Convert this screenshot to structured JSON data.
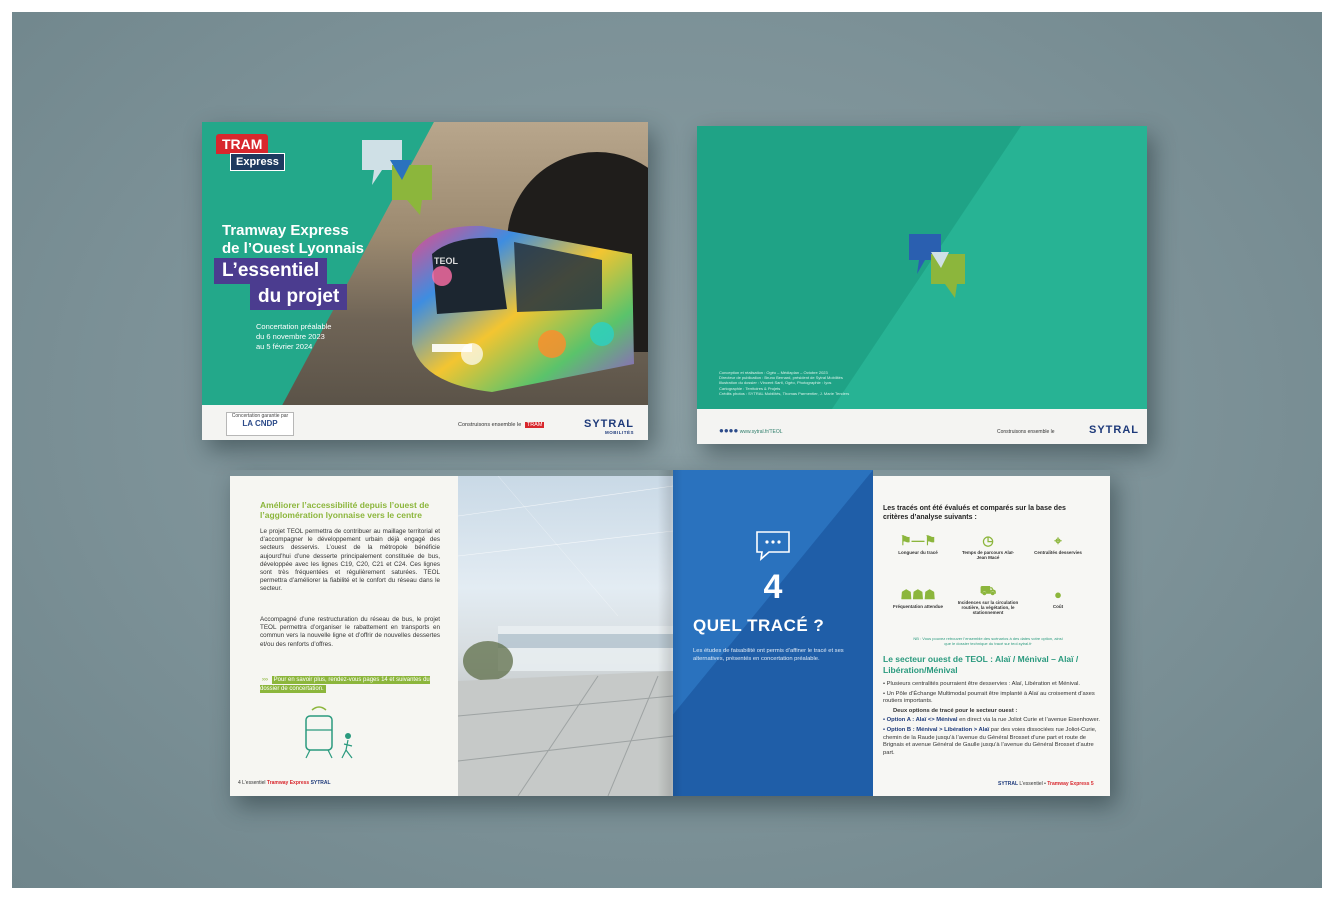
{
  "cover_front": {
    "logo_tram": "TRAM",
    "logo_express": "Express",
    "title_line1": "Tramway Express",
    "title_line2": "de l’Ouest Lyonnais",
    "band1": "L’essentiel",
    "band2": "du projet",
    "concertation_1": "Concertation préalable",
    "concertation_2": "du 6 novembre 2023",
    "concertation_3": "au 5 février 2024",
    "tram_dest": "TEOL",
    "footer_left_caption": "Concertation garantie par",
    "footer_left_logo": "LA CNDP",
    "footer_mid": "Construisons ensemble le",
    "sytral": "SYTRAL",
    "sytral_sub": "MOBILITÉS"
  },
  "cover_back": {
    "credits": [
      "Conception et réalisation : Ogéo – Médiaplan – Octobre 2023",
      "Directeur de publication : Bruno Bernard, président de Sytral Mobilités",
      "Illustration du dossier : Vincent Sarti, Ogéo, Photographie : Iyos",
      "Cartographie : Territoires & Projets",
      "Crédits photos : SYTRAL Mobilités, Thomas Parmentier, J. Marie Tenders"
    ],
    "footer_left": "www.sytral.fr/TEOL",
    "footer_mid": "Construisons ensemble le",
    "sytral": "SYTRAL"
  },
  "spread": {
    "left_title": "Améliorer l’accessibilité depuis l’ouest de l’agglomération lyonnaise vers le centre",
    "left_p1": "Le projet TEOL permettra de contribuer au maillage territorial et d’accompagner le développement urbain déjà engagé des secteurs desservis. L’ouest de la métropole bénéficie aujourd’hui d’une desserte principalement constituée de bus, développée avec les lignes C19, C20, C21 et C24. Ces lignes sont très fréquentées et régulièrement saturées. TEOL permettra d’améliorer la fiabilité et le confort du réseau dans le secteur.",
    "left_p2": "Accompagné d’une restructuration du réseau de bus, le projet TEOL permettra d’organiser le rabattement en transports en commun vers la nouvelle ligne et d’offrir de nouvelles dessertes et/ou des renforts d’offres.",
    "left_link": "Pour en savoir plus, rendez-vous pages 14 et suivantes du dossier de concertation.",
    "left_footer_a": "4  L’essentiel",
    "left_footer_b": "Tramway Express",
    "left_footer_c": "SYTRAL",
    "blue_number": "4",
    "blue_title": "QUEL TRACÉ ?",
    "blue_sub": "Les études de faisabilité ont permis d’affiner le tracé et ses alternatives, présentés en concertation préalable.",
    "right_intro": "Les tracés ont été évalués et comparés sur la base des critères d’analyse suivants :",
    "criteria": [
      {
        "icon": "flag-icon",
        "label": "Longueur du tracé"
      },
      {
        "icon": "clock-icon",
        "label": "Temps de parcours Alaï-Jean Macé"
      },
      {
        "icon": "pin-icon",
        "label": "Centralités desservies"
      },
      {
        "icon": "people-icon",
        "label": "Fréquentation attendue"
      },
      {
        "icon": "car-icon",
        "label": "Incidences sur la circulation routière, la végétation, le stationnement"
      },
      {
        "icon": "piggy-icon",
        "label": "Coût"
      }
    ],
    "right_note": "NB : Vous pouvez retrouver l’ensemble des scénarios à des dates votre option, ainsi que le dossier technique du tracé sur teol.sytral.fr",
    "right_heading": "Le secteur ouest de TEOL : Alaï / Ménival – Alaï / Libération/Ménival",
    "right_b1": "• Plusieurs centralités pourraient être desservies : Alaï, Libération et Ménival.",
    "right_b2": "• Un Pôle d’Échange Multimodal pourrait être implanté à Alaï au croisement d’axes routiers importants.",
    "right_options": "Deux options de tracé pour le secteur ouest :",
    "right_optA_label": "• Option A : Alaï <> Ménival",
    "right_optA": " en direct via la rue Joliot Curie et l’avenue Eisenhower.",
    "right_optB_label": "• Option B : Ménival > Libération > Alaï",
    "right_optB": " par des voies dissociées rue Joliot-Curie, chemin de la Raude jusqu’à l’avenue du Général Brosset d’une part et route de Brignais et avenue Général de Gaulle jusqu’à l’avenue du Général Brosset d’autre part.",
    "right_footer_a": "SYTRAL",
    "right_footer_b": "L’essentiel •",
    "right_footer_c": "Tramway Express  5"
  },
  "colors": {
    "teal": "#23a88a",
    "purple": "#4b3c8f",
    "blue": "#2a72be",
    "lime": "#8cb63c",
    "red": "#d8272d",
    "navy": "#1e3a7a"
  }
}
